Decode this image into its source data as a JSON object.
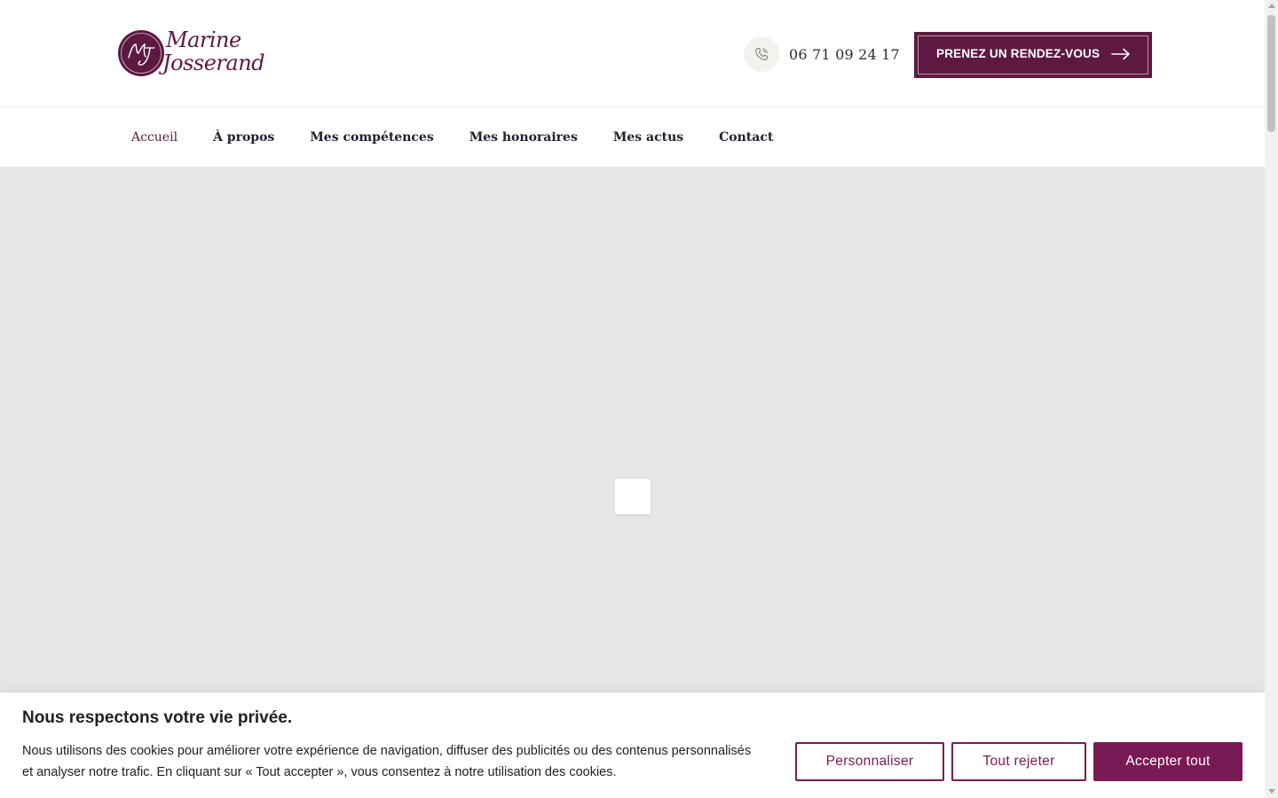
{
  "brand": {
    "line1": "Marine",
    "line2": "Josserand",
    "accent_color": "#5e1942",
    "logo_icon": "mj-monogram-icon"
  },
  "header": {
    "phone_icon": "phone-icon",
    "phone_number": "06 71 09 24 17",
    "cta_label": "PRENEZ UN RENDEZ-VOUS",
    "cta_icon": "arrow-right-icon"
  },
  "nav": {
    "items": [
      {
        "label": "Accueil",
        "active": true
      },
      {
        "label": "À propos",
        "active": false
      },
      {
        "label": "Mes compétences",
        "active": false
      },
      {
        "label": "Mes honoraires",
        "active": false
      },
      {
        "label": "Mes actus",
        "active": false
      },
      {
        "label": "Contact",
        "active": false
      }
    ]
  },
  "hero": {
    "background_color": "#e6e6e6",
    "loader_icon": "loading-placeholder-icon"
  },
  "cookie": {
    "title": "Nous respectons votre vie privée.",
    "text": "Nous utilisons des cookies pour améliorer votre expérience de navigation, diffuser des publicités ou des contenus personnalisés et analyser notre trafic. En cliquant sur « Tout accepter », vous consentez à notre utilisation des cookies.",
    "customize_label": "Personnaliser",
    "reject_label": "Tout rejeter",
    "accept_label": "Accepter tout",
    "button_color": "#7a1a54"
  }
}
